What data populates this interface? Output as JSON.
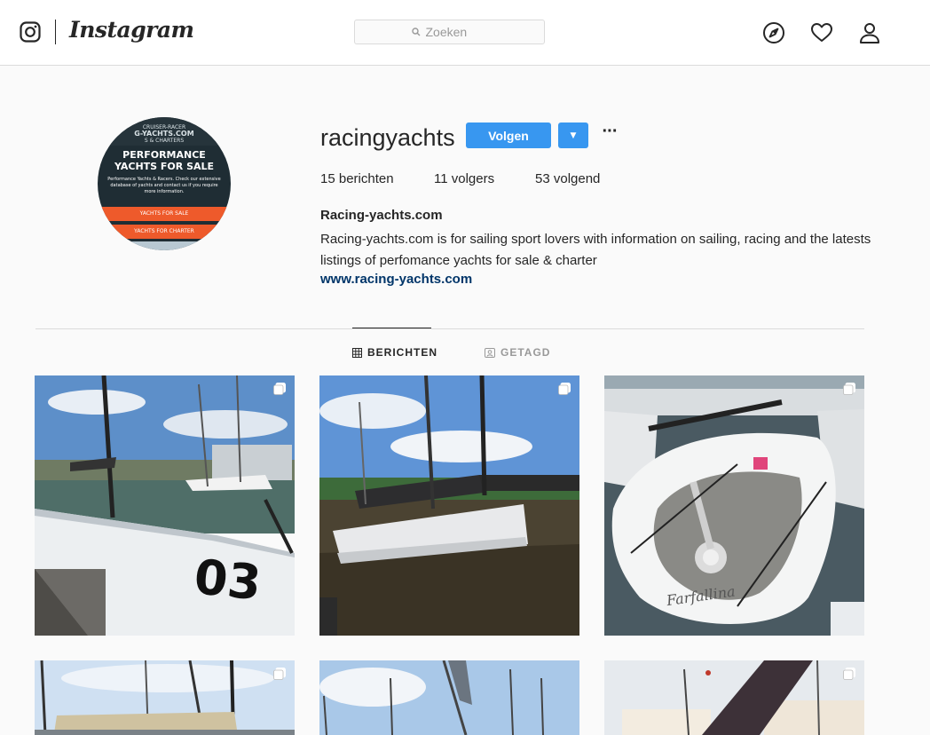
{
  "header": {
    "logo_text": "Instagram",
    "search_placeholder": "Zoeken"
  },
  "icons": {
    "camera": "instagram-camera-icon",
    "search": "search-icon",
    "explore": "compass-icon",
    "activity": "heart-icon",
    "profile": "person-icon"
  },
  "profile": {
    "username": "racingyachts",
    "follow_label": "Volgen",
    "dropdown_label": "▼",
    "more_label": "···",
    "stats": {
      "posts_count": "15",
      "posts_label": "berichten",
      "followers_count": "11",
      "followers_label": "volgers",
      "following_count": "53",
      "following_label": "volgend"
    },
    "bio": {
      "name": "Racing-yachts.com",
      "text": "Racing-yachts.com is for sailing sport lovers with information on sailing, racing and the latests listings of perfomance yachts for sale & charter",
      "link": "www.racing-yachts.com"
    },
    "avatar": {
      "top_line1": "CRUISER-RACER",
      "top_line2": "G-YACHTS.COM",
      "top_line3": "S & CHARTERS",
      "headline": "PERFORMANCE YACHTS FOR SALE",
      "body": "Performance Yachts & Racers. Check our extensive database of yachts and contact us if you require more information.",
      "button1": "YACHTS FOR SALE",
      "button2": "YACHTS FOR CHARTER"
    }
  },
  "tabs": [
    {
      "label": "BERICHTEN",
      "active": true
    },
    {
      "label": "GETAGD",
      "active": false
    }
  ],
  "posts": [
    {
      "alt": "White racing yacht with number 03 in harbour",
      "sail_number": "03"
    },
    {
      "alt": "Grey sailboat moored at a dock"
    },
    {
      "alt": "White yacht deck viewed from above",
      "hull_name": "Farfallina"
    },
    {
      "alt": "Sailboat with cream boom cover"
    },
    {
      "alt": "Masts against a blue sky"
    },
    {
      "alt": "Dark sail near buildings"
    }
  ],
  "colors": {
    "accent": "#3897f0",
    "link": "#003569",
    "border": "#dbdbdb",
    "background": "#fafafa"
  }
}
